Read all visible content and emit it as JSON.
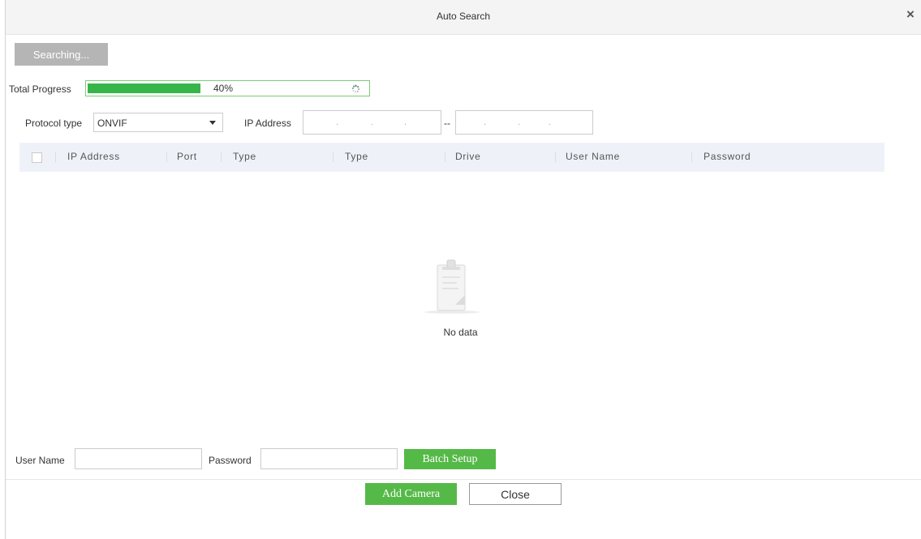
{
  "dialog": {
    "title": "Auto Search",
    "close_icon": "×"
  },
  "toolbar": {
    "searching_label": "Searching..."
  },
  "progress": {
    "label": "Total Progress",
    "percent": 40,
    "percent_text": "40%",
    "icon": "spinner-icon"
  },
  "filters": {
    "protocol_label": "Protocol type",
    "protocol_value": "ONVIF",
    "ip_label": "IP Address",
    "ip_range_separator": "--",
    "ip_dot": "."
  },
  "table": {
    "columns": [
      "IP Address",
      "Port",
      "Type",
      "Type",
      "Drive",
      "User Name",
      "Password"
    ],
    "empty_text": "No data"
  },
  "batch": {
    "username_label": "User Name",
    "password_label": "Password",
    "setup_label": "Batch Setup"
  },
  "footer": {
    "add_label": "Add Camera",
    "close_label": "Close"
  },
  "colors": {
    "accent": "#55b947",
    "progress_fill": "#38b54a",
    "header_bg": "#eef2f8"
  }
}
